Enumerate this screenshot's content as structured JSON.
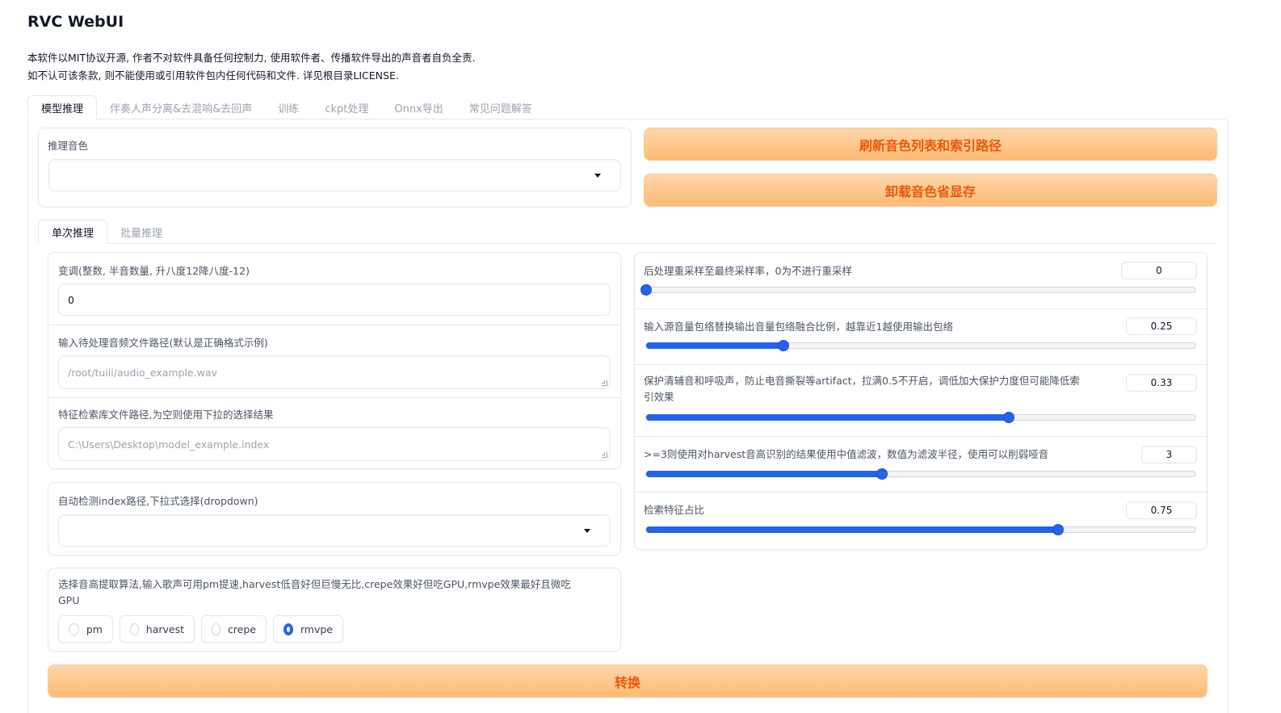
{
  "app": {
    "title": "RVC WebUI",
    "desc_line1": "本软件以MIT协议开源, 作者不对软件具备任何控制力, 使用软件者、传播软件导出的声音者自负全责.",
    "desc_line2": "如不认可该条款, 则不能使用或引用软件包内任何代码和文件. 详见根目录LICENSE."
  },
  "main_tabs": [
    "模型推理",
    "伴奏人声分离&去混响&去回声",
    "训练",
    "ckpt处理",
    "Onnx导出",
    "常见问题解答"
  ],
  "voice": {
    "label": "推理音色",
    "value": ""
  },
  "buttons": {
    "refresh": "刷新音色列表和索引路径",
    "unload": "卸载音色省显存",
    "convert": "转换"
  },
  "sub_tabs": [
    "单次推理",
    "批量推理"
  ],
  "left": {
    "pitch_label": "变调(整数, 半音数量, 升八度12降八度-12)",
    "pitch_value": "0",
    "audio_label": "输入待处理音频文件路径(默认是正确格式示例)",
    "audio_placeholder": "/root/tuili/audio_example.wav",
    "index_label": "特征检索库文件路径,为空则使用下拉的选择结果",
    "index_placeholder": "C:\\Users\\Desktop\\model_example.index",
    "auto_index_label": "自动检测index路径,下拉式选择(dropdown)",
    "auto_index_value": "",
    "f0_label_line1": "选择音高提取算法,输入歌声可用pm提速,harvest低音好但巨慢无比,crepe效果好但吃GPU,rmvpe效果最好且微吃",
    "f0_label_line2": "GPU",
    "f0_options": [
      "pm",
      "harvest",
      "crepe",
      "rmvpe"
    ],
    "f0_selected": "rmvpe"
  },
  "right": {
    "sliders": [
      {
        "label": "后处理重采样至最终采样率，0为不进行重采样",
        "value": "0",
        "fraction": 0.0
      },
      {
        "label": "输入源音量包络替换输出音量包络融合比例，越靠近1越使用输出包络",
        "value": "0.25",
        "fraction": 0.25
      },
      {
        "label_line1": "保护清辅音和呼吸声，防止电音撕裂等artifact，拉满0.5不开启，调低加大保护力度但可能降低索",
        "label_line2": "引效果",
        "value": "0.33",
        "fraction": 0.66
      },
      {
        "label": ">=3则使用对harvest音高识别的结果使用中值滤波，数值为滤波半径，使用可以削弱哑音",
        "value": "3",
        "fraction": 0.43
      },
      {
        "label": "检索特征占比",
        "value": "0.75",
        "fraction": 0.75
      }
    ]
  },
  "colors": {
    "accent": "#2563eb",
    "button_text": "#ea580c",
    "button_bg_top": "#fed7aa",
    "button_bg_bottom": "#fdba74"
  }
}
